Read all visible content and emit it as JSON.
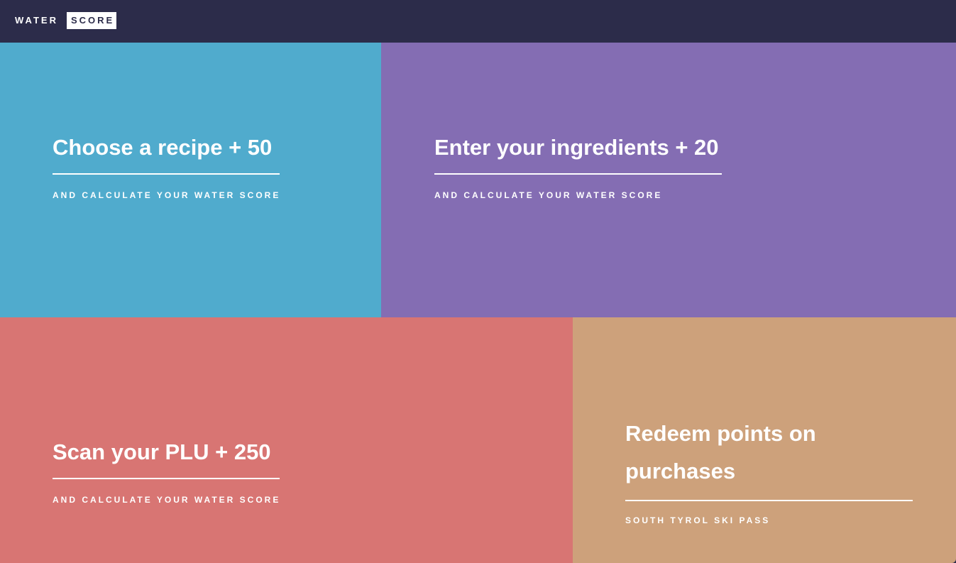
{
  "header": {
    "logo_word_1": "WATER",
    "logo_word_2": "SCORE",
    "background": "#2c2c4a"
  },
  "tiles": [
    {
      "title": "Choose a recipe + 50",
      "subtitle": "AND CALCULATE YOUR WATER SCORE",
      "color": "#50abcd"
    },
    {
      "title": "Enter your ingredients + 20",
      "subtitle": "AND CALCULATE YOUR WATER SCORE",
      "color": "#846db3"
    },
    {
      "title": "Scan your PLU + 250",
      "subtitle": "AND CALCULATE YOUR WATER SCORE",
      "color": "#d87573"
    },
    {
      "title": "Redeem points on purchases",
      "subtitle": "SOUTH TYROL SKI PASS",
      "color": "#cda17b"
    }
  ]
}
